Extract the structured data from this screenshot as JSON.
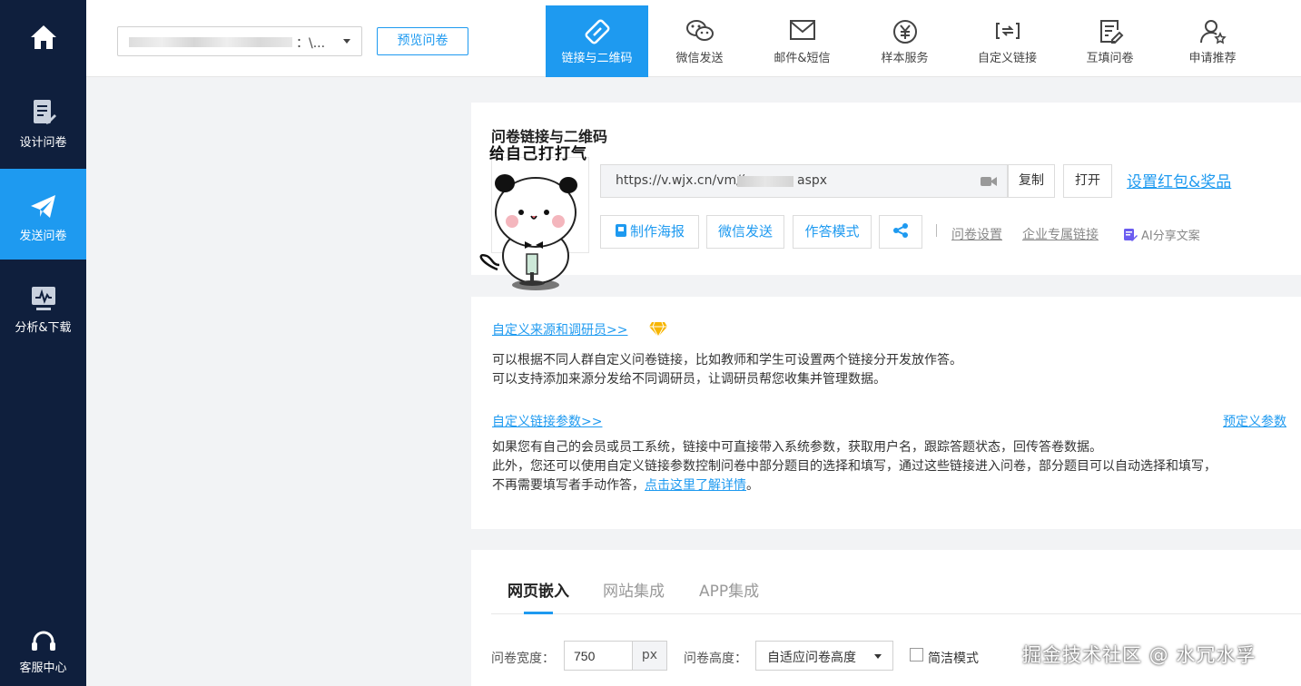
{
  "sidebar": {
    "items": [
      {
        "label": ""
      },
      {
        "label": "设计问卷"
      },
      {
        "label": "发送问卷"
      },
      {
        "label": "分析&下载"
      }
    ],
    "service_label": "客服中心"
  },
  "topbar": {
    "survey_select_text": "：\\...",
    "preview_label": "预览问卷",
    "tabs": [
      {
        "label": "链接与二维码"
      },
      {
        "label": "微信发送"
      },
      {
        "label": "邮件&短信"
      },
      {
        "label": "样本服务"
      },
      {
        "label": "自定义链接"
      },
      {
        "label": "互填问卷"
      },
      {
        "label": "申请推荐"
      }
    ]
  },
  "link_card": {
    "title": "问卷链接与二维码",
    "sticker_text": "给自己打打气",
    "url_prefix": "https://v.wjx.cn/vm/(",
    "url_suffix": "aspx",
    "copy_label": "复制",
    "open_label": "打开",
    "redpack_link": "设置红包&奖品",
    "actions": {
      "poster": "制作海报",
      "wechat": "微信发送",
      "answer_mode": "作答模式"
    },
    "survey_settings": "问卷设置",
    "enterprise_link": "企业专属链接",
    "ai_share": "AI分享文案"
  },
  "custom_card": {
    "source_link": "自定义来源和调研员>>",
    "source_desc_1": "可以根据不同人群自定义问卷链接，比如教师和学生可设置两个链接分开发放作答。",
    "source_desc_2": "可以支持添加来源分发给不同调研员，让调研员帮您收集并管理数据。",
    "param_link": "自定义链接参数>>",
    "predefined_link": "预定义参数",
    "param_desc_1": "如果您有自己的会员或员工系统，链接中可直接带入系统参数，获取用户名，跟踪答题状态，回传答卷数据。",
    "param_desc_2": "此外，您还可以使用自定义链接参数控制问卷中部分题目的选择和填写，通过这些链接进入问卷，部分题目可以自动选择和填写，",
    "param_desc_3_prefix": "不再需要填写者手动作答，",
    "param_desc_3_link": "点击这里了解详情",
    "param_desc_3_suffix": "。"
  },
  "embed_card": {
    "tabs": [
      {
        "label": "网页嵌入"
      },
      {
        "label": "网站集成"
      },
      {
        "label": "APP集成"
      }
    ],
    "width_label": "问卷宽度：",
    "width_value": "750",
    "width_unit": "px",
    "height_label": "问卷高度：",
    "height_value": "自适应问卷高度",
    "simple_mode_label": "简洁模式",
    "simple_mode_checked": false
  },
  "watermark": "掘金技术社区 @ 水冗水孚",
  "colors": {
    "sidebar_bg": "#0f1f3d",
    "accent": "#1e9af0",
    "page_bg": "#f2f3f5"
  }
}
